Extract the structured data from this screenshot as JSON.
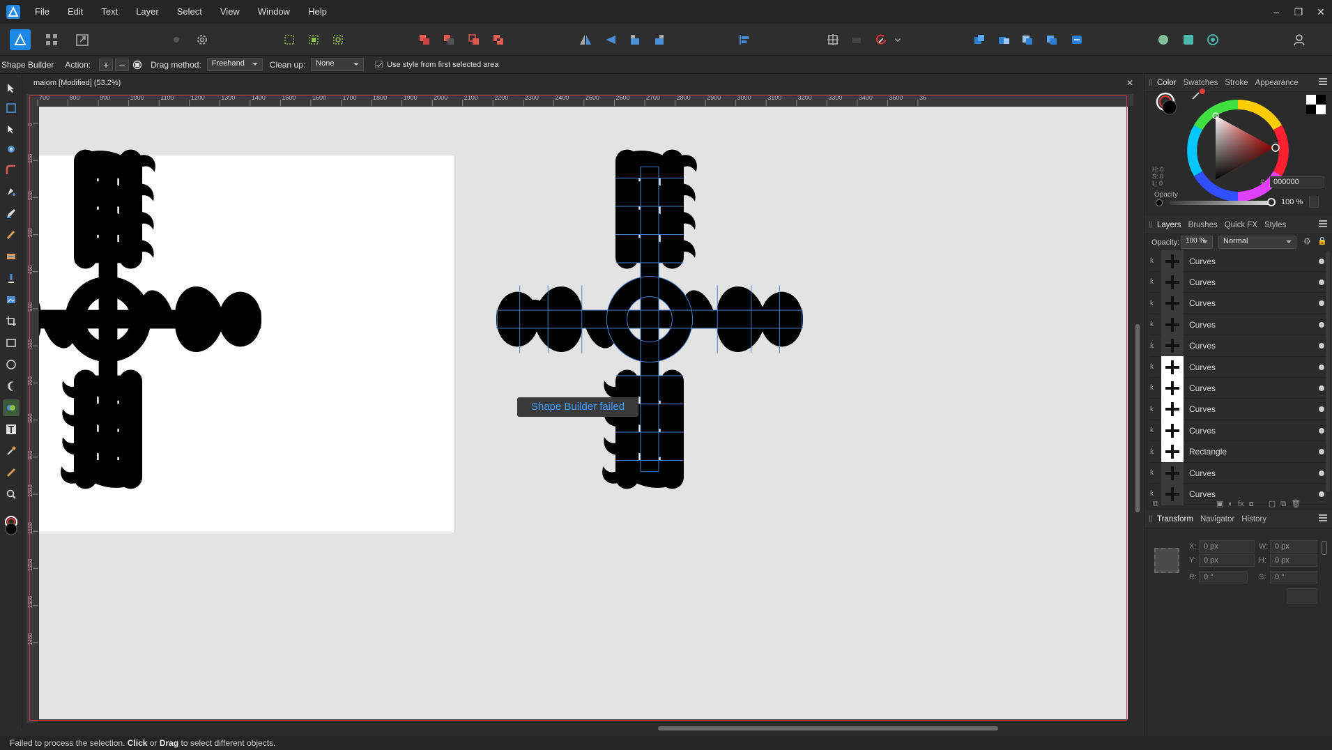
{
  "app": {
    "logo_icon": "affinity-designer-logo",
    "brand_color": "#1e88e5"
  },
  "menu": {
    "items": [
      "File",
      "Edit",
      "Text",
      "Layer",
      "Select",
      "View",
      "Window",
      "Help"
    ]
  },
  "window_controls": {
    "minimize": "–",
    "restore": "❐",
    "close": "✕"
  },
  "context_bar": {
    "tool_name": "Shape Builder",
    "action_label": "Action:",
    "add_symbol": "+",
    "subtract_symbol": "–",
    "drag_method_label": "Drag method:",
    "drag_method_value": "Freehand",
    "cleanup_label": "Clean up:",
    "cleanup_value": "None",
    "use_style_label": "Use style from first selected area"
  },
  "document": {
    "tab_title": "maiom [Modified] (53.2%)",
    "close_symbol": "✕",
    "ruler_h_ticks": [
      "700",
      "800",
      "900",
      "1000",
      "1100",
      "1200",
      "1300",
      "1400",
      "1500",
      "1600",
      "1700",
      "1800",
      "1900",
      "2000",
      "2100",
      "2200",
      "2300",
      "2400",
      "2500",
      "2600",
      "2700",
      "2800",
      "2900",
      "3000",
      "3100",
      "3200",
      "3300",
      "3400",
      "3500",
      "36"
    ],
    "ruler_v_ticks": [
      "0",
      "100",
      "200",
      "300",
      "400",
      "500",
      "600",
      "700",
      "800",
      "900",
      "1000",
      "1100",
      "1200",
      "1300",
      "1400"
    ],
    "toast": "Shape Builder failed"
  },
  "status": {
    "prefix": "Failed to process the selection.",
    "click": "Click",
    "or": "or",
    "drag": "Drag",
    "suffix": "to select different objects."
  },
  "color_panel": {
    "tabs": [
      "Color",
      "Swatches",
      "Stroke",
      "Appearance"
    ],
    "active_tab": "Color",
    "h": "H: 0",
    "s": "S: 0",
    "l": "L: 0",
    "hex_prefix": "#:",
    "hex_value": "000000",
    "opacity_label": "Opacity",
    "opacity_value": "100 %",
    "current_color": "#000000",
    "selected_hue_color": "#ff0000"
  },
  "layers_panel": {
    "tabs": [
      "Layers",
      "Brushes",
      "Quick FX",
      "Styles"
    ],
    "active_tab": "Layers",
    "opacity_label": "Opacity:",
    "opacity_value": "100 %",
    "blend_mode": "Normal",
    "layers": [
      {
        "name": "Curves",
        "thumb": "dark"
      },
      {
        "name": "Curves",
        "thumb": "dark"
      },
      {
        "name": "Curves",
        "thumb": "dark"
      },
      {
        "name": "Curves",
        "thumb": "dark"
      },
      {
        "name": "Curves",
        "thumb": "dark"
      },
      {
        "name": "Curves",
        "thumb": "white"
      },
      {
        "name": "Curves",
        "thumb": "white"
      },
      {
        "name": "Curves",
        "thumb": "white"
      },
      {
        "name": "Curves",
        "thumb": "white"
      },
      {
        "name": "Rectangle",
        "thumb": "white"
      },
      {
        "name": "Curves",
        "thumb": "dark"
      },
      {
        "name": "Curves",
        "thumb": "dark"
      }
    ]
  },
  "transform_panel": {
    "tabs": [
      "Transform",
      "Navigator",
      "History"
    ],
    "active_tab": "Transform",
    "x_label": "X:",
    "x_value": "0 px",
    "y_label": "Y:",
    "y_value": "0 px",
    "w_label": "W:",
    "w_value": "0 px",
    "h_label": "H:",
    "h_value": "0 px",
    "r_label": "R:",
    "r_value": "0 °",
    "s_label": "S:",
    "s_value": "0 °"
  }
}
